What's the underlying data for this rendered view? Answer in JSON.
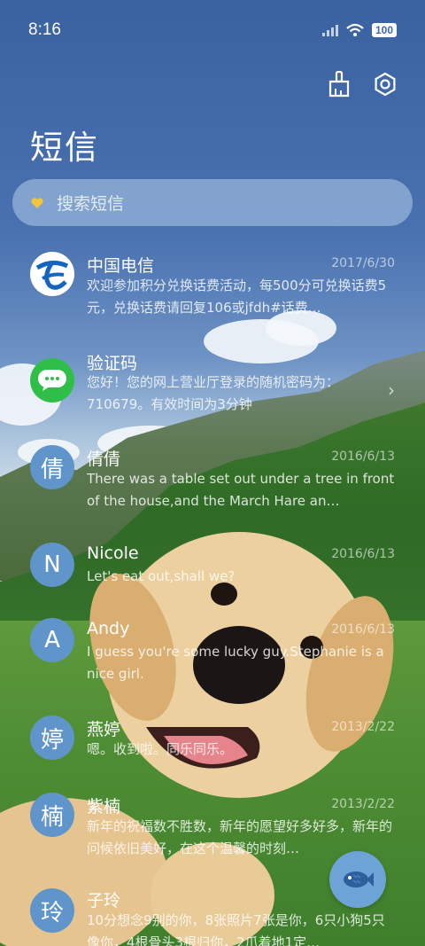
{
  "status_bar": {
    "time": "8:16",
    "battery": "100"
  },
  "header": {
    "title": "短信"
  },
  "search": {
    "placeholder": "搜索短信"
  },
  "conversations": [
    {
      "avatar": "",
      "name": "中国电信",
      "date": "2017/6/30",
      "preview": "欢迎参加积分兑换话费活动，每500分可兑换话费5元，兑换话费请回复106或jfdh#话费…"
    },
    {
      "avatar": "",
      "name": "验证码",
      "date": "",
      "preview": "您好！您的网上营业厅登录的随机密码为：710679。有效时间为3分钟"
    },
    {
      "avatar": "倩",
      "name": "倩倩",
      "date": "2016/6/13",
      "preview": "There was a table set out under a tree in front of the house,and the March Hare an…"
    },
    {
      "avatar": "N",
      "name": "Nicole",
      "date": "2016/6/13",
      "preview": "Let's eat out,shall we?"
    },
    {
      "avatar": "A",
      "name": "Andy",
      "date": "2016/6/13",
      "preview": "I guess you're some lucky guy.Stephanie is a nice girl."
    },
    {
      "avatar": "婷",
      "name": "燕婷",
      "date": "2013/2/22",
      "preview": "嗯。收到啦。同乐同乐。"
    },
    {
      "avatar": "楠",
      "name": "紫楠",
      "date": "2013/2/22",
      "preview": "新年的祝福数不胜数，新年的愿望好多好多，新年的问候依旧美好，在这个温馨的时刻…"
    },
    {
      "avatar": "玲",
      "name": "子玲",
      "date": "",
      "preview": "10分想念9别的你，8张照片7张是你，6只小狗5只像你，4根骨头3根归你，2爪着地1定…"
    }
  ]
}
